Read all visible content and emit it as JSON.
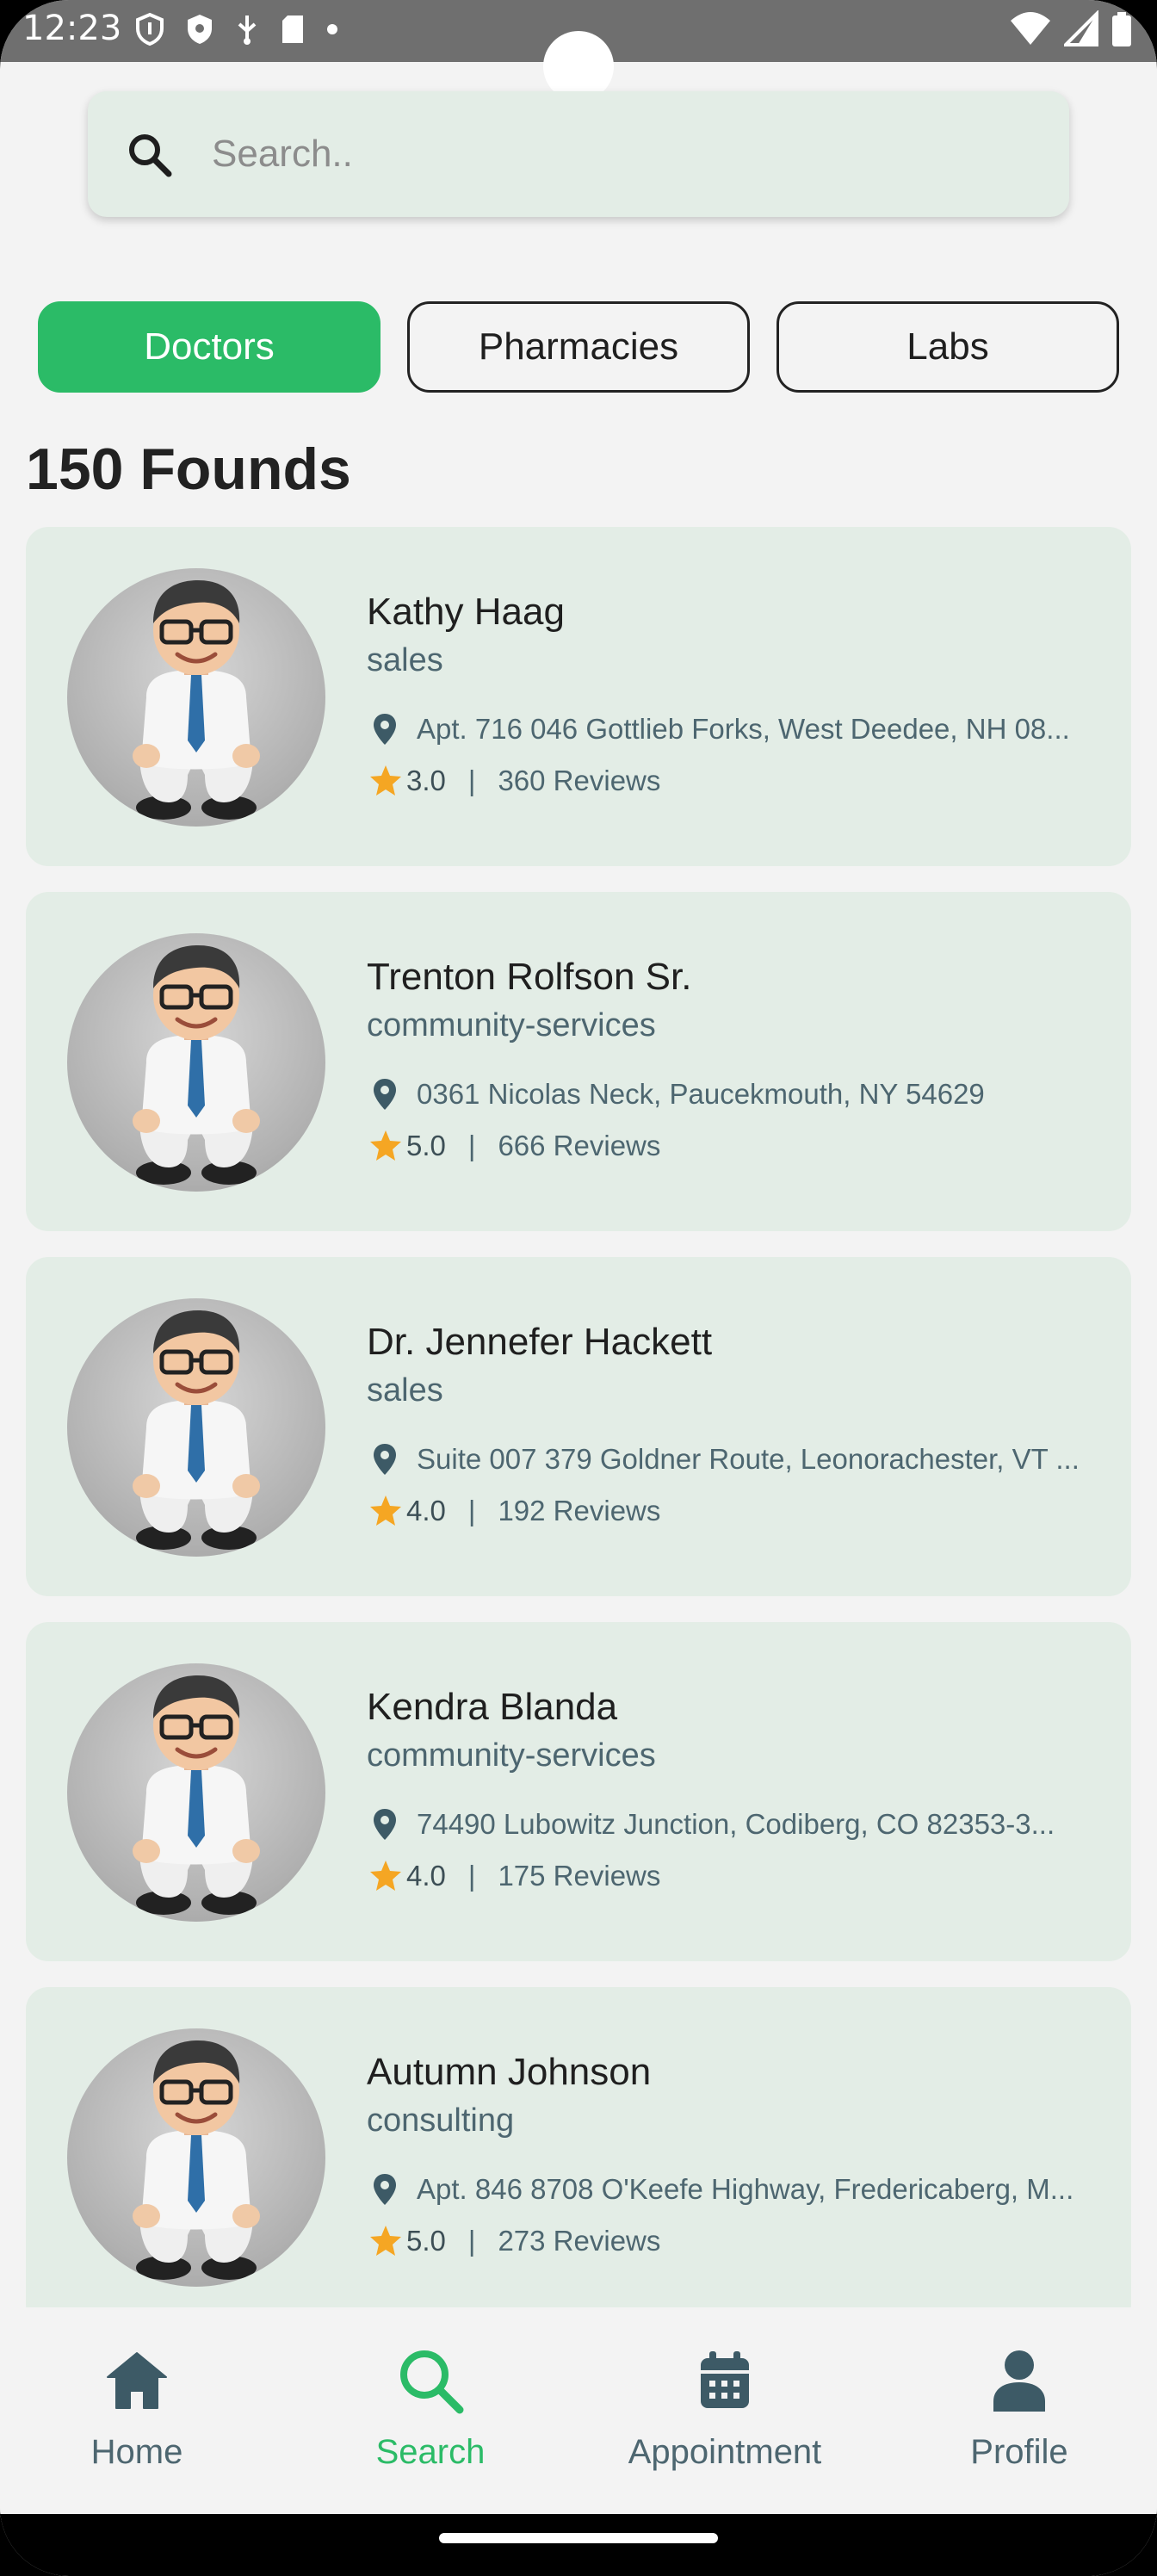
{
  "status_bar": {
    "time": "12:23",
    "left_icons": [
      "shield-outline-icon",
      "shield-filled-icon",
      "usb-icon",
      "sd-card-icon",
      "dot-icon"
    ],
    "right_icons": [
      "wifi-icon",
      "signal-icon",
      "battery-icon"
    ]
  },
  "search": {
    "placeholder": "Search.."
  },
  "tabs": [
    {
      "label": "Doctors",
      "active": true
    },
    {
      "label": "Pharmacies",
      "active": false
    },
    {
      "label": "Labs",
      "active": false
    }
  ],
  "results_title": "150 Founds",
  "results": [
    {
      "name": "Kathy Haag",
      "category": "sales",
      "address": "Apt. 716 046 Gottlieb Forks, West Deedee, NH 08...",
      "rating": "3.0",
      "reviews": "360 Reviews"
    },
    {
      "name": "Trenton Rolfson Sr.",
      "category": "community-services",
      "address": "0361 Nicolas Neck, Paucekmouth, NY 54629",
      "rating": "5.0",
      "reviews": "666 Reviews"
    },
    {
      "name": "Dr. Jennefer Hackett",
      "category": "sales",
      "address": "Suite 007 379 Goldner Route, Leonorachester, VT ...",
      "rating": "4.0",
      "reviews": "192 Reviews"
    },
    {
      "name": "Kendra Blanda",
      "category": "community-services",
      "address": "74490 Lubowitz Junction, Codiberg, CO 82353-3...",
      "rating": "4.0",
      "reviews": "175 Reviews"
    },
    {
      "name": "Autumn Johnson",
      "category": "consulting",
      "address": "Apt. 846 8708 O'Keefe Highway, Fredericaberg, M...",
      "rating": "5.0",
      "reviews": "273 Reviews"
    }
  ],
  "rating_separator": "|",
  "bottom_nav": [
    {
      "label": "Home",
      "icon": "home-icon",
      "active": false
    },
    {
      "label": "Search",
      "icon": "search-icon",
      "active": true
    },
    {
      "label": "Appointment",
      "icon": "calendar-icon",
      "active": false
    },
    {
      "label": "Profile",
      "icon": "person-icon",
      "active": false
    }
  ],
  "colors": {
    "accent": "#2bbb67",
    "card_bg": "#e3ede6",
    "secondary_text": "#4d6670",
    "star": "#f5a623",
    "icon_dark": "#3d5a66"
  }
}
